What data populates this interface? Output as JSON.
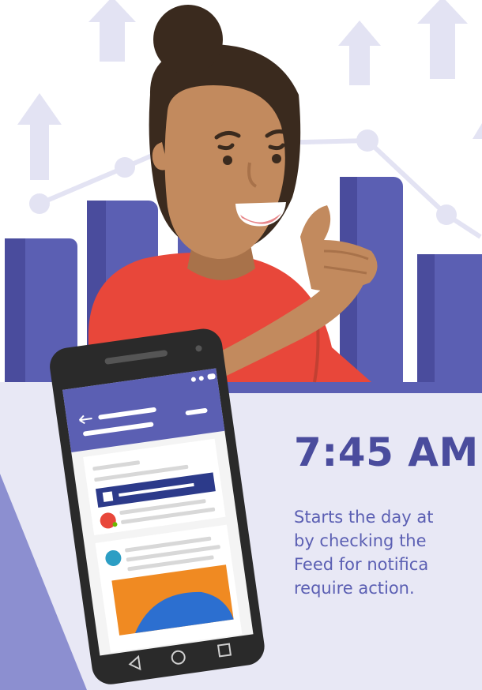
{
  "card": {
    "time": "7:45 AM",
    "description_lines": [
      "Starts the day at",
      "by checking the",
      "Feed for notifica",
      "require action."
    ]
  },
  "colors": {
    "background": "#ffffff",
    "panel": "#e8e8f5",
    "bars": "#5b5fb3",
    "bars_dark": "#4a4c9d",
    "trend": "#e3e3f3",
    "phone_body": "#2a2a2a",
    "app_header": "#5b5fb3",
    "skin": "#c28a5e",
    "hair": "#3a2a1e",
    "shirt": "#e8473a"
  },
  "icons": [
    "up-arrow-icon",
    "back-arrow-icon",
    "home-circle-icon",
    "back-triangle-icon",
    "recent-square-icon"
  ]
}
